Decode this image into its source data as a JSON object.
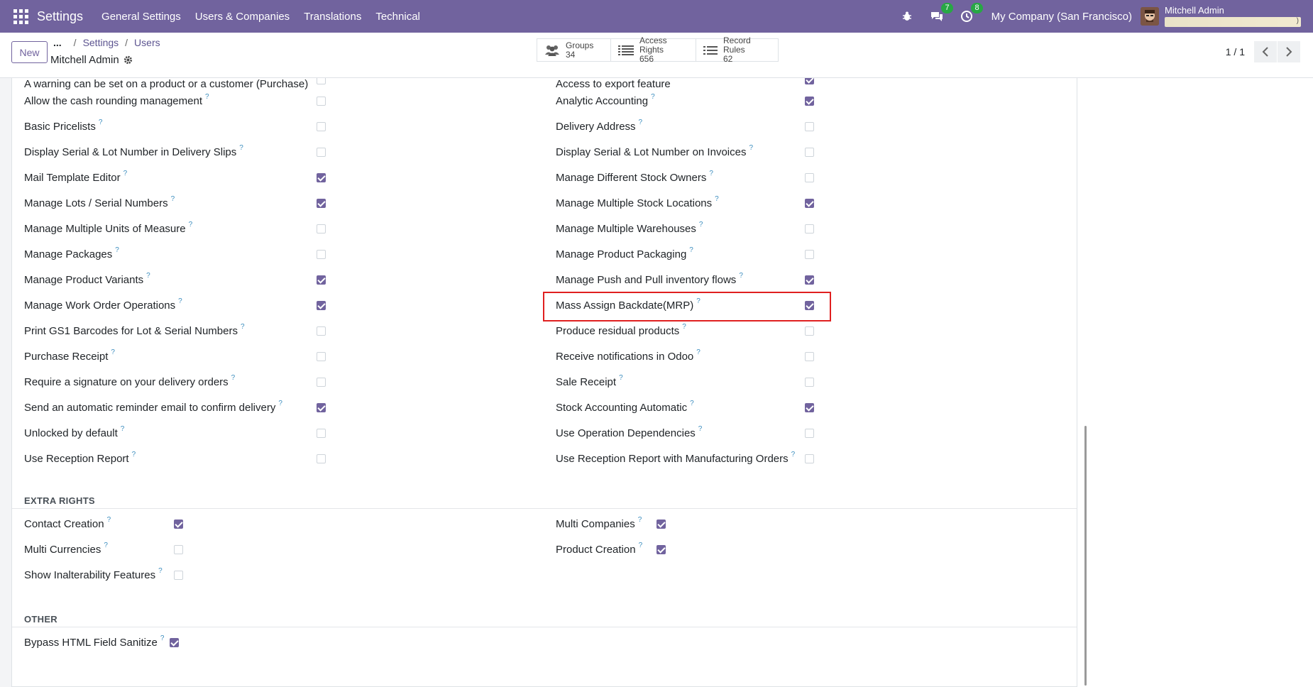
{
  "navbar": {
    "brand": "Settings",
    "menu": [
      "General Settings",
      "Users & Companies",
      "Translations",
      "Technical"
    ],
    "chat_badge": "7",
    "activity_badge": "8",
    "company": "My Company (San Francisco)",
    "user": "Mitchell Admin"
  },
  "control": {
    "new_label": "New",
    "breadcrumb_dots": "...",
    "crumbs": [
      "Settings",
      "Users"
    ],
    "record_title": "Mitchell Admin",
    "stats": [
      {
        "label": "Groups",
        "count": "34"
      },
      {
        "label": "Access Rights",
        "count": "656"
      },
      {
        "label": "Record Rules",
        "count": "62"
      }
    ],
    "pager": "1 / 1"
  },
  "technical": {
    "partial_left": "A warning can be set on a product or a customer (Purchase)",
    "partial_right": "Access to export feature",
    "left": [
      {
        "label": "Allow the cash rounding management",
        "checked": false
      },
      {
        "label": "Basic Pricelists",
        "checked": false
      },
      {
        "label": "Display Serial & Lot Number in Delivery Slips",
        "checked": false
      },
      {
        "label": "Mail Template Editor",
        "checked": true
      },
      {
        "label": "Manage Lots / Serial Numbers",
        "checked": true
      },
      {
        "label": "Manage Multiple Units of Measure",
        "checked": false
      },
      {
        "label": "Manage Packages",
        "checked": false
      },
      {
        "label": "Manage Product Variants",
        "checked": true
      },
      {
        "label": "Manage Work Order Operations",
        "checked": true
      },
      {
        "label": "Print GS1 Barcodes for Lot & Serial Numbers",
        "checked": false
      },
      {
        "label": "Purchase Receipt",
        "checked": false
      },
      {
        "label": "Require a signature on your delivery orders",
        "checked": false
      },
      {
        "label": "Send an automatic reminder email to confirm delivery",
        "checked": true
      },
      {
        "label": "Unlocked by default",
        "checked": false
      },
      {
        "label": "Use Reception Report",
        "checked": false
      }
    ],
    "right": [
      {
        "label": "Analytic Accounting",
        "checked": true
      },
      {
        "label": "Delivery Address",
        "checked": false
      },
      {
        "label": "Display Serial & Lot Number on Invoices",
        "checked": false
      },
      {
        "label": "Manage Different Stock Owners",
        "checked": false
      },
      {
        "label": "Manage Multiple Stock Locations",
        "checked": true
      },
      {
        "label": "Manage Multiple Warehouses",
        "checked": false
      },
      {
        "label": "Manage Product Packaging",
        "checked": false
      },
      {
        "label": "Manage Push and Pull inventory flows",
        "checked": true
      },
      {
        "label": "Mass Assign Backdate(MRP)",
        "checked": true
      },
      {
        "label": "Produce residual products",
        "checked": false
      },
      {
        "label": "Receive notifications in Odoo",
        "checked": false
      },
      {
        "label": "Sale Receipt",
        "checked": false
      },
      {
        "label": "Stock Accounting Automatic",
        "checked": true
      },
      {
        "label": "Use Operation Dependencies",
        "checked": false
      },
      {
        "label": "Use Reception Report with Manufacturing Orders",
        "checked": false
      }
    ]
  },
  "extra_rights": {
    "title": "EXTRA RIGHTS",
    "left": [
      {
        "label": "Contact Creation",
        "checked": true
      },
      {
        "label": "Multi Currencies",
        "checked": false
      },
      {
        "label": "Show Inalterability Features",
        "checked": false
      }
    ],
    "right": [
      {
        "label": "Multi Companies",
        "checked": true
      },
      {
        "label": "Product Creation",
        "checked": true
      }
    ]
  },
  "other": {
    "title": "OTHER",
    "left": [
      {
        "label": "Bypass HTML Field Sanitize",
        "checked": true
      }
    ]
  },
  "help_mark": "?"
}
